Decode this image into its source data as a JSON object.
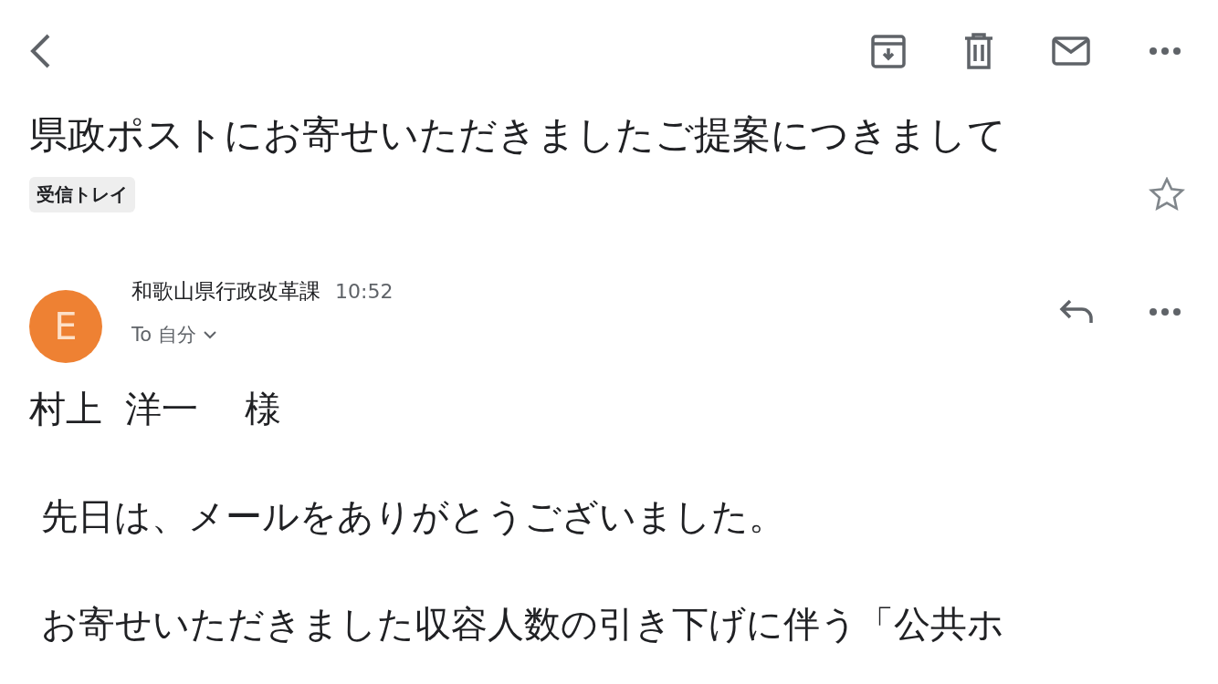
{
  "toolbar": {
    "actions": [
      {
        "kind": "archive"
      },
      {
        "kind": "delete"
      },
      {
        "kind": "unread"
      },
      {
        "kind": "more"
      }
    ]
  },
  "subject": "県政ポストにお寄せいただきましたご提案につきまして",
  "label": "受信トレイ",
  "starred": false,
  "message": {
    "avatar_letter": "E",
    "sender": "和歌山県行政改革課",
    "time": "10:52",
    "to_prefix": "To",
    "to": "自分"
  },
  "body": [
    "村上  洋一    様",
    " 先日は、メールをありがとうございました。",
    " お寄せいただきました収容人数の引き下げに伴う「公共ホ"
  ]
}
